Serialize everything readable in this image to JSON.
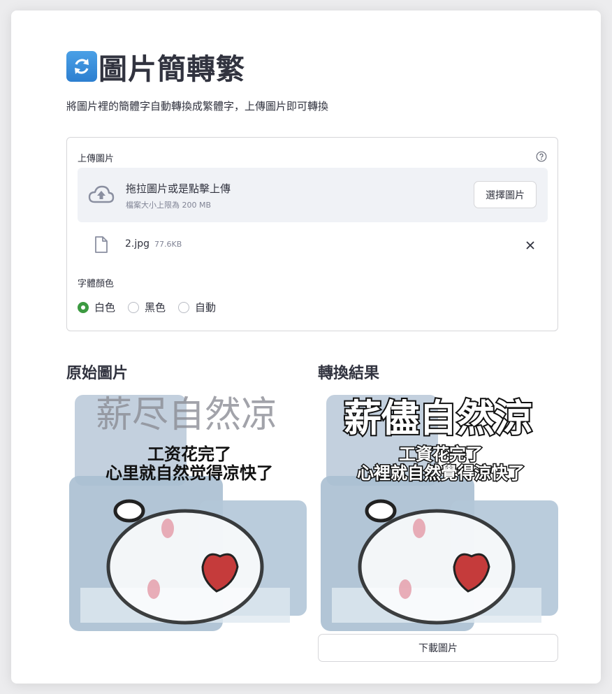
{
  "header": {
    "icon": "arrows-counterclockwise-icon",
    "title": "圖片簡轉繁",
    "subtitle": "將圖片裡的簡體字自動轉換成繁體字，上傳圖片即可轉換"
  },
  "uploader": {
    "label": "上傳圖片",
    "drop_main": "拖拉圖片或是點擊上傳",
    "drop_sub": "檔案大小上限為 200 MB",
    "browse_label": "選擇圖片",
    "file": {
      "name": "2.jpg",
      "size": "77.6KB"
    }
  },
  "font_color": {
    "label": "字體顏色",
    "options": [
      "白色",
      "黑色",
      "自動"
    ],
    "selected": "白色"
  },
  "original": {
    "heading": "原始圖片",
    "caption_big": "薪尽自然凉",
    "caption_line1": "工资花完了",
    "caption_line2": "心里就自然觉得凉快了"
  },
  "result": {
    "heading": "轉換結果",
    "caption_big": "薪儘自然涼",
    "caption_line1": "工資花完了",
    "caption_line2": "心裡就自然覺得涼快了",
    "download_label": "下載圖片"
  },
  "colors": {
    "accent": "#3c9a41",
    "text": "#31333f",
    "muted": "#808495",
    "dropzone_bg": "#f0f2f6"
  }
}
